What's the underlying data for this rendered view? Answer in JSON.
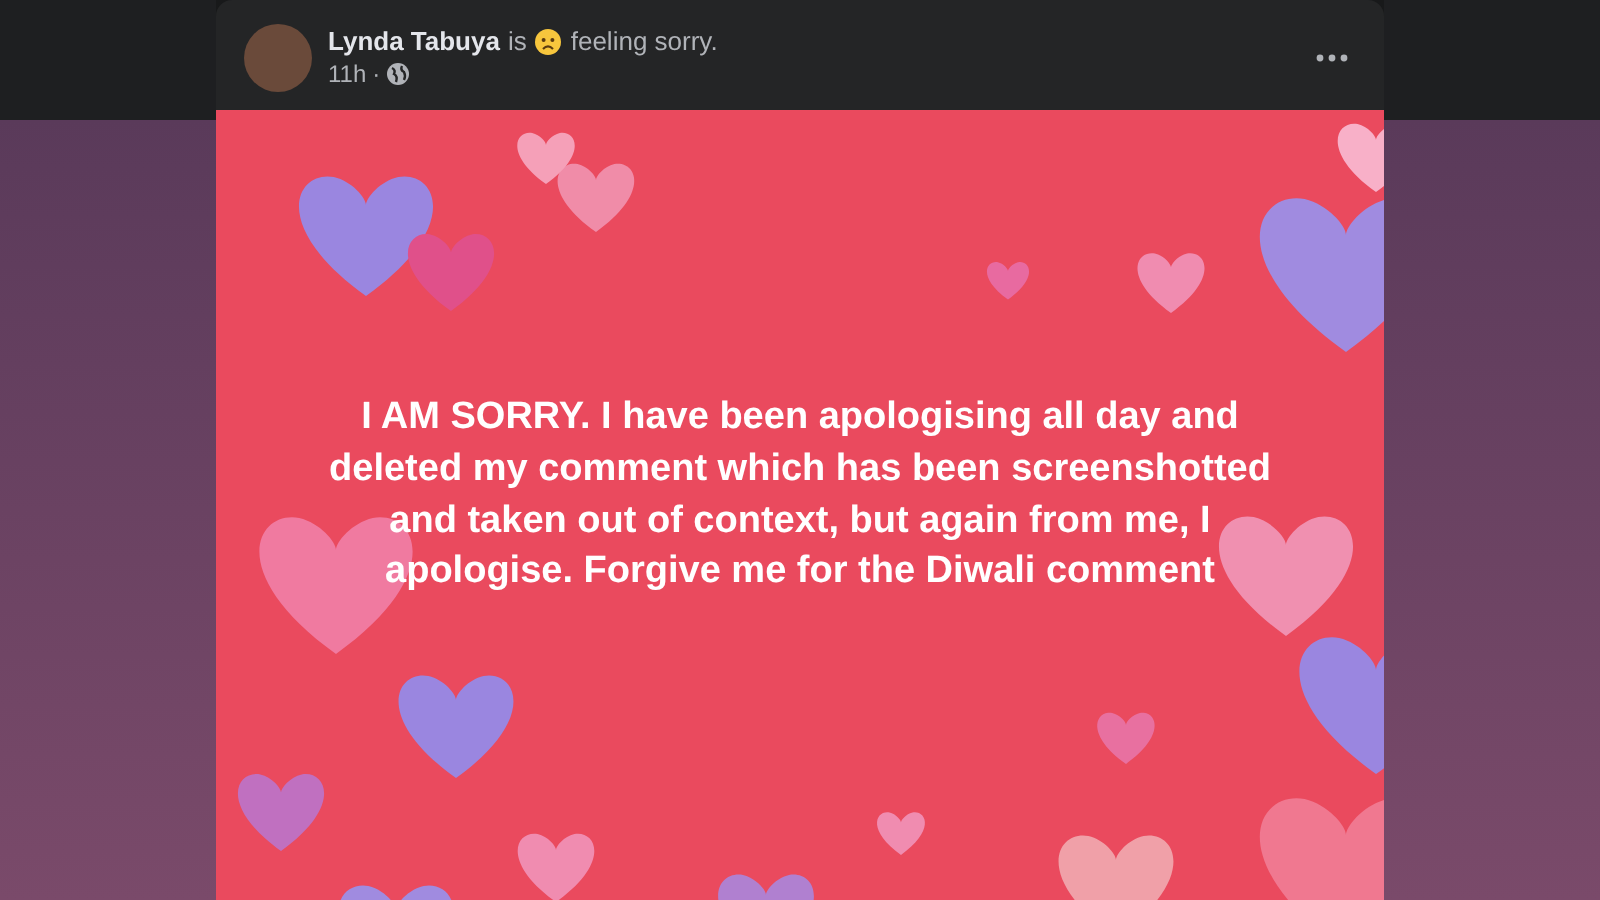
{
  "post": {
    "author": "Lynda Tabuya",
    "verb": "is",
    "feeling": "feeling sorry.",
    "time": "11h",
    "separator": "·",
    "body": "I AM SORRY. I have been apologising all day and deleted my comment which has been screenshotted and taken out of context, but again from me, I apologise. Forgive me for the Diwali comment"
  }
}
